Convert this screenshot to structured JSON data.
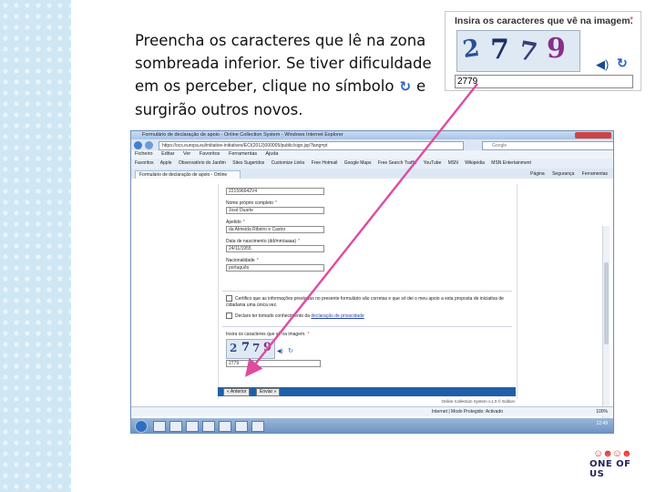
{
  "instruction": {
    "line1": "Preencha os caracteres que lê na zona",
    "line2": "sombreada inferior.  Se tiver dificuldade",
    "line3_a": "em os perceber, clique no símbolo",
    "line3_b": "e",
    "line4": "surgirão outros novos.",
    "refresh_icon": "refresh-icon"
  },
  "zoom": {
    "label": "Insira os caracteres que vê na imagem.",
    "required_mark": "*",
    "captcha_chars": [
      "2",
      "7",
      "7",
      "9"
    ],
    "input_value": "2779",
    "speaker_icon": "speaker-icon",
    "refresh_icon": "refresh-icon"
  },
  "browser": {
    "title": "Formulário de declaração de apoio - Online Collection System - Windows Internet Explorer",
    "address": "https://ocs.europa.eu/initiative-initiatives/ECI(2012)000005/public/sign.jsp?lang=pt",
    "search_placeholder": "Google",
    "menu": [
      "Ficheiro",
      "Editar",
      "Ver",
      "Favoritos",
      "Ferramentas",
      "Ajuda"
    ],
    "favorites": [
      "Favoritos",
      "Apple",
      "Observatório do Jardim",
      "Sites Sugeridos",
      "Customize Links",
      "Free Hotmail",
      "Google Maps",
      "Free Search Traffic",
      "YouTube",
      "MSN",
      "Wikipédia",
      "MSN Entertainment"
    ],
    "tab_label": "Formulário de declaração de apoio - Online Collec...",
    "tab_tools": [
      "Página",
      "Segurança",
      "Ferramentas"
    ],
    "fields": [
      {
        "label": "",
        "value": "221596642V4"
      },
      {
        "label": "Nome próprio completo",
        "value": "José Duarte"
      },
      {
        "label": "Apelido",
        "value": "da Almeida Ribeiro e Castro"
      },
      {
        "label": "Data de nascimento (dd/mm/aaaa)",
        "value": "24/11/1955"
      },
      {
        "label": "Nacionalidade",
        "value": "português"
      }
    ],
    "checkbox1": "Certifico que as informações prestadas no presente formulário são corretas e que só dei o meu apoio a esta proposta de iniciativa de cidadania uma única vez.",
    "checkbox2_prefix": "Declaro ter tomado conhecimento da",
    "checkbox2_link": "declaração de privacidade",
    "small_captcha_label": "Insira os caracteres que vê na imagem.",
    "small_captcha_value": "2779",
    "buttons": [
      "« Anterior",
      "Enviar »"
    ],
    "footer": "Online Collection System  v.1.0 © Edition",
    "status_text": "Internet | Modo Protegido: Activado",
    "zoom_level": "100%",
    "clock": "12:49"
  },
  "logo": {
    "text": "ONE OF US"
  },
  "colors": {
    "arrow": "#e04aa0",
    "side_strip": "#cfe7f5",
    "link": "#2244aa"
  }
}
